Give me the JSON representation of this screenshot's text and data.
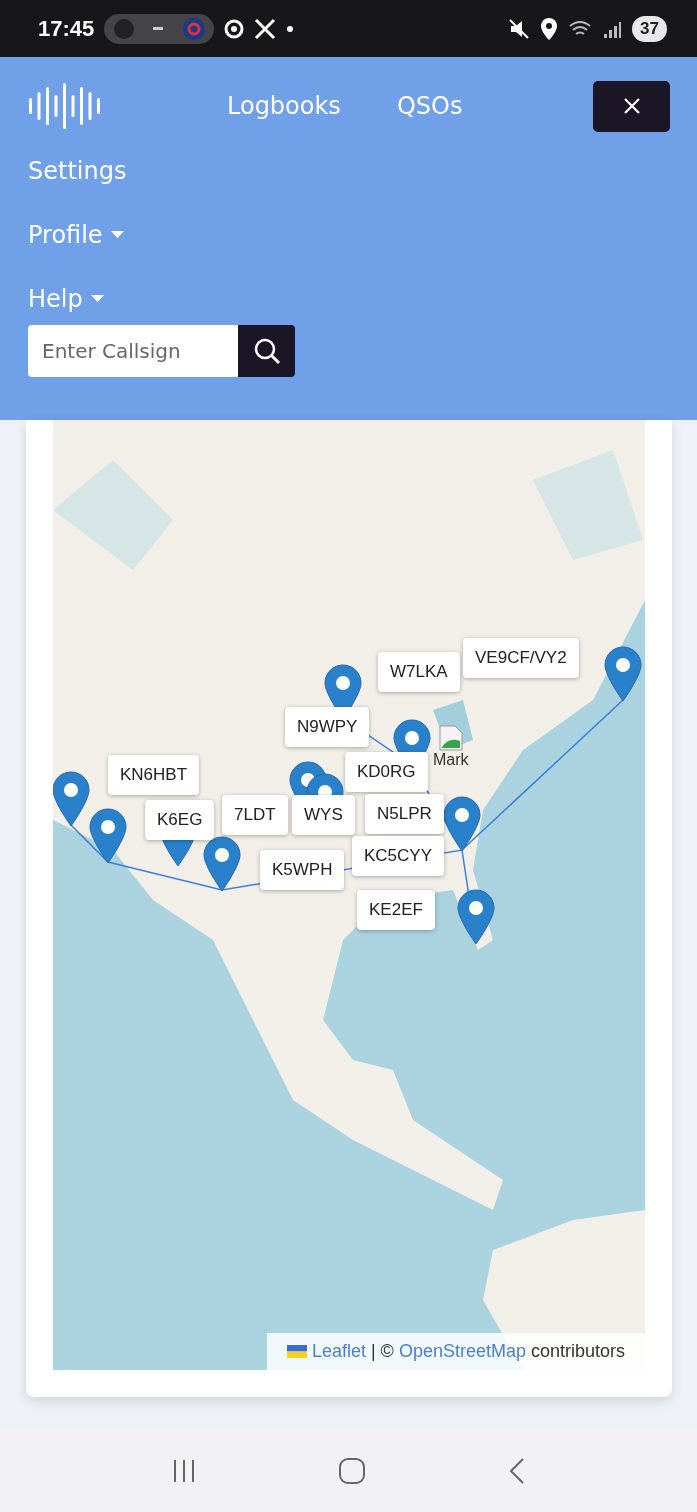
{
  "status_bar": {
    "time": "17:45",
    "battery": "37"
  },
  "nav": {
    "links": [
      {
        "label": "Logbooks"
      },
      {
        "label": "QSOs"
      }
    ],
    "menu": [
      {
        "label": "Settings",
        "dropdown": false
      },
      {
        "label": "Profile",
        "dropdown": true
      },
      {
        "label": "Help",
        "dropdown": true
      }
    ],
    "search": {
      "placeholder": "Enter Callsign"
    }
  },
  "map": {
    "labels": [
      "W7LKA",
      "VE9CF/VY2",
      "N9WPY",
      "KN6HBT",
      "K6EG",
      "7LDT",
      "WYS",
      "KD0RG",
      "N5LPR",
      "KC5CYY",
      "K5WPH",
      "KE2EF"
    ],
    "broken_image": {
      "alt": "Mark"
    },
    "attribution": {
      "leaflet": "Leaflet",
      "separator": "| ©",
      "osm": "OpenStreetMap",
      "suffix": "contributors"
    }
  }
}
